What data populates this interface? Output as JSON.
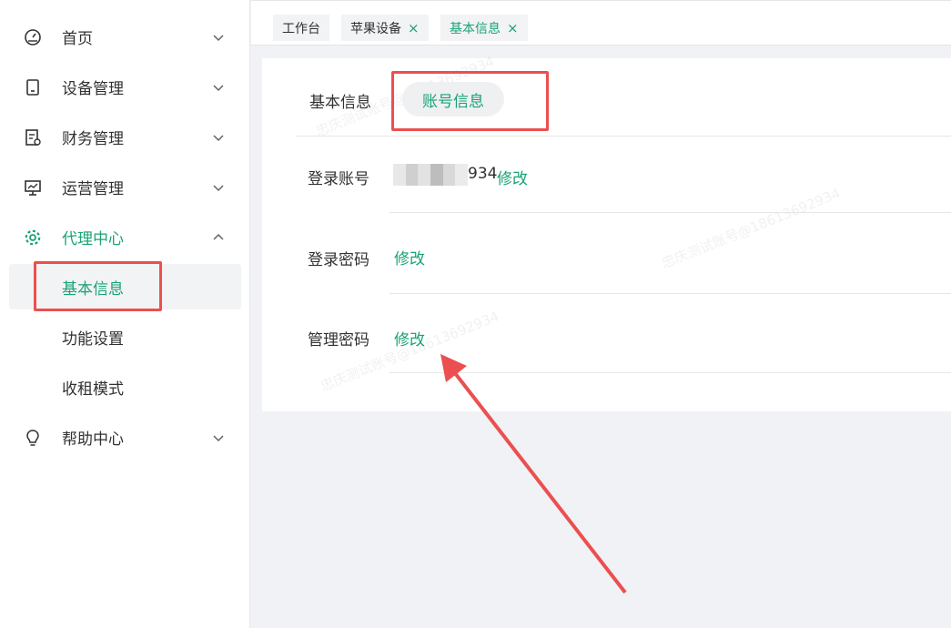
{
  "sidebar": {
    "items": [
      {
        "label": "首页",
        "icon": "dashboard-gauge-icon"
      },
      {
        "label": "设备管理",
        "icon": "device-tablet-icon"
      },
      {
        "label": "财务管理",
        "icon": "finance-document-icon"
      },
      {
        "label": "运营管理",
        "icon": "monitor-chart-icon"
      },
      {
        "label": "代理中心",
        "icon": "gear-icon"
      },
      {
        "label": "帮助中心",
        "icon": "lightbulb-icon"
      }
    ],
    "sub_items": [
      {
        "label": "基本信息"
      },
      {
        "label": "功能设置"
      },
      {
        "label": "收租模式"
      }
    ]
  },
  "tabs": [
    {
      "label": "工作台"
    },
    {
      "label": "苹果设备",
      "close": "×"
    },
    {
      "label": "基本信息",
      "close": "×"
    }
  ],
  "main": {
    "section_label": "基本信息",
    "pill_label": "账号信息",
    "rows": [
      {
        "label": "登录账号",
        "value_suffix": "934",
        "action": "修改"
      },
      {
        "label": "登录密码",
        "action": "修改"
      },
      {
        "label": "管理密码",
        "action": "修改"
      }
    ],
    "watermark": "忠庆测试账号@18613692934"
  },
  "colors": {
    "accent": "#19a374",
    "highlight": "#ec4f4f",
    "text": "#303133",
    "background": "#f0f2f5"
  }
}
